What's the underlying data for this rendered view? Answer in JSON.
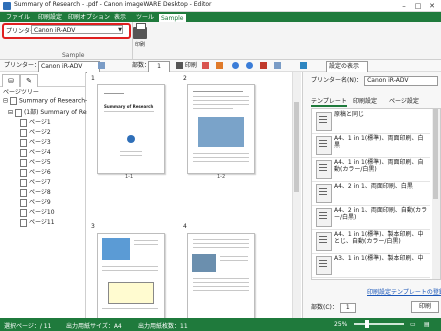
{
  "window": {
    "title": "Summary of Research - .pdf - Canon imageWARE Desktop - Editor",
    "minimize": "–",
    "maximize": "□",
    "close": "✕"
  },
  "menu": {
    "items": [
      "ファイル",
      "印刷設定",
      "印刷オプション",
      "表示",
      "ツール",
      "Sample"
    ],
    "active_index": 5
  },
  "ribbon": {
    "printer_label": "プリンター：",
    "printer_value": "Canon iR-ADV",
    "print_button": "印刷",
    "group_label": "Sample"
  },
  "toolbar": {
    "printer_label": "プリンター：",
    "printer_value": "Canon iR-ADV",
    "copies_label": "部数：",
    "copies_value": "1",
    "print_label": "印刷",
    "show_panel_label": "設定の表示"
  },
  "left_panel": {
    "title": "ページツリー",
    "doc_root": "Summary of Research-...",
    "doc_child": "(1部) Summary of Rese...",
    "pages": [
      "ページ1",
      "ページ2",
      "ページ3",
      "ページ4",
      "ページ5",
      "ページ6",
      "ページ7",
      "ページ8",
      "ページ9",
      "ページ10",
      "ページ11"
    ]
  },
  "workspace": {
    "pages": [
      {
        "num": "1",
        "caption": "1-1",
        "heading": "Summary of Research"
      },
      {
        "num": "2",
        "caption": "1-2",
        "heading": ""
      },
      {
        "num": "3",
        "caption": "",
        "heading": ""
      },
      {
        "num": "4",
        "caption": "",
        "heading": ""
      }
    ]
  },
  "right_panel": {
    "printer_label": "プリンター名(N)：",
    "printer_value": "Canon iR-ADV",
    "tabs": [
      "テンプレート",
      "印刷設定",
      "ページ設定"
    ],
    "selected_tab": 0,
    "templates": [
      "原稿と同じ",
      "A4、1 in 1(標準)、両面印刷、白黒",
      "A4、1 in 1(標準)、両面印刷、自動(カラー/白黒)",
      "A4、2 in 1、両面印刷、白黒",
      "A4、2 in 1、両面印刷、自動(カラー/白黒)",
      "A4、1 in 1(標準)、製本印刷、中とじ、自動(カラー/白黒)",
      "A3、1 in 1(標準)、製本印刷、中"
    ],
    "register_link": "印刷設定テンプレートの登録",
    "copies_label": "部数(C)：",
    "copies_value": "1",
    "print_button": "印刷"
  },
  "status": {
    "selected_page": "選択ページ：/ 11",
    "output_size": "出力用紙サイズ：A4",
    "output_sheets": "出力用紙枚数：11",
    "zoom": "25%"
  },
  "colors": {
    "accent": "#1f7a3c",
    "highlight": "#e02020",
    "link": "#1a56b8"
  }
}
